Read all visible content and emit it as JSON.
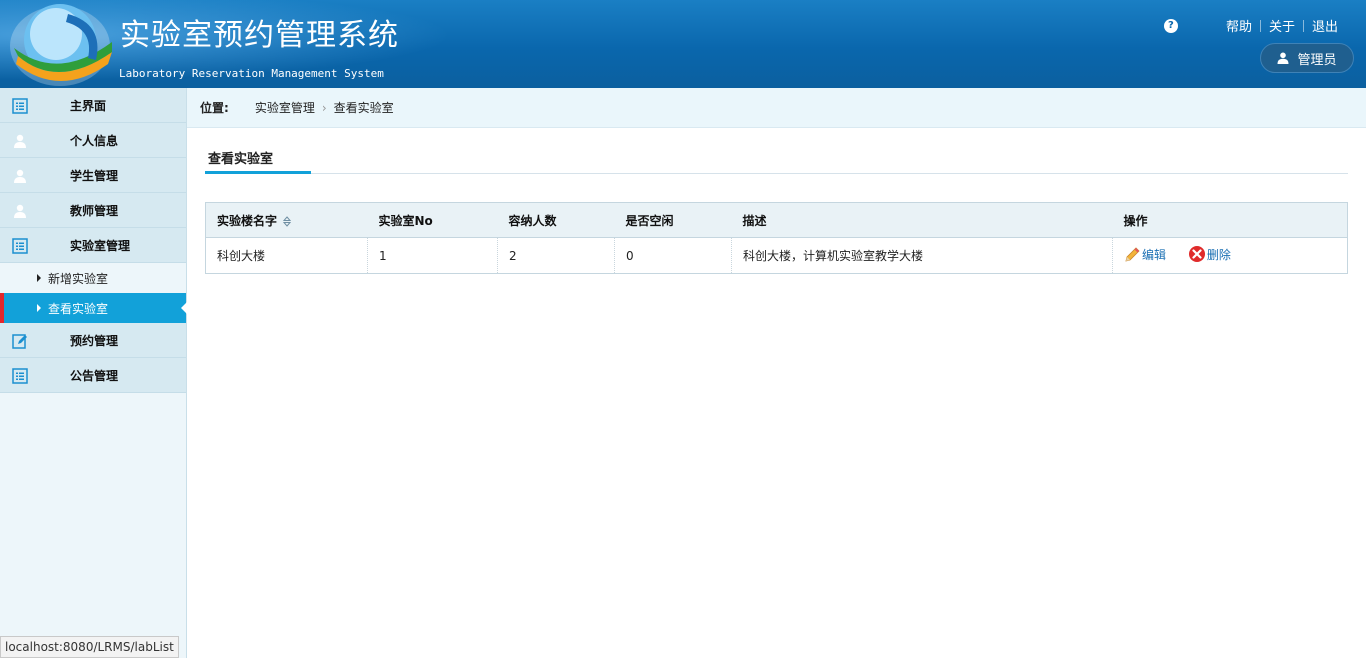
{
  "header": {
    "title": "实验室预约管理系统",
    "subtitle": "Laboratory Reservation Management System",
    "help_icon": "question-icon",
    "links": {
      "help": "帮助",
      "about": "关于",
      "logout": "退出"
    },
    "user": "管理员"
  },
  "sidebar": {
    "items": [
      {
        "label": "主界面",
        "icon": "list-icon"
      },
      {
        "label": "个人信息",
        "icon": "user-icon"
      },
      {
        "label": "学生管理",
        "icon": "user-icon"
      },
      {
        "label": "教师管理",
        "icon": "user-icon"
      },
      {
        "label": "实验室管理",
        "icon": "list-icon"
      },
      {
        "label": "预约管理",
        "icon": "edit-icon"
      },
      {
        "label": "公告管理",
        "icon": "list-icon"
      }
    ],
    "sub_items": [
      {
        "label": "新增实验室",
        "active": false
      },
      {
        "label": "查看实验室",
        "active": true
      }
    ]
  },
  "status_url": "localhost:8080/LRMS/labList",
  "breadcrumb": {
    "label": "位置:",
    "parent": "实验室管理",
    "current": "查看实验室"
  },
  "tab": {
    "label": "查看实验室"
  },
  "table": {
    "headers": [
      "实验楼名字",
      "实验室No",
      "容纳人数",
      "是否空闲",
      "描述",
      "操作"
    ],
    "rows": [
      {
        "building": "科创大楼",
        "lab_no": "1",
        "capacity": "2",
        "idle": "0",
        "description": "科创大楼，计算机实验室教学大楼",
        "edit": "编辑",
        "delete": "删除"
      }
    ]
  },
  "colors": {
    "header_blue": "#0a67ad",
    "accent": "#12a1d9",
    "active_marker": "#e3262b",
    "link": "#1a6fb3"
  }
}
